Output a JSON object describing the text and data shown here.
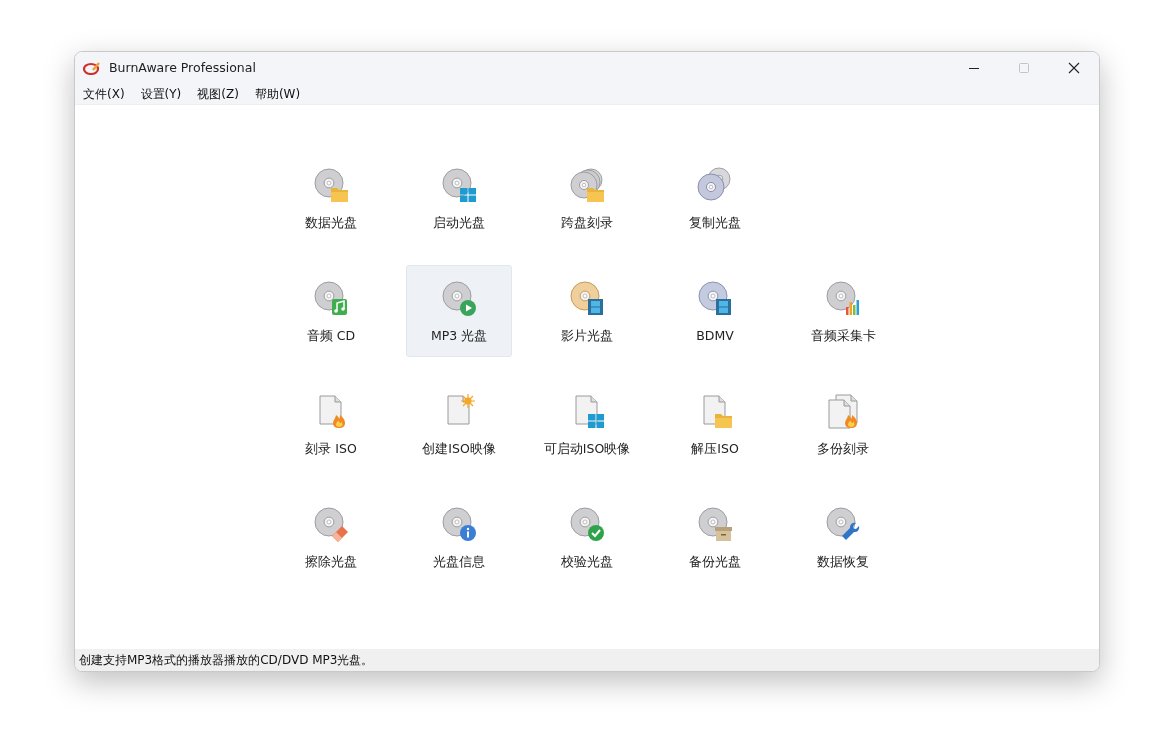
{
  "window": {
    "title": "BurnAware Professional",
    "maximize_disabled": true
  },
  "menu": [
    {
      "label": "文件(X)"
    },
    {
      "label": "设置(Y)"
    },
    {
      "label": "视图(Z)"
    },
    {
      "label": "帮助(W)"
    }
  ],
  "rows": [
    [
      {
        "label": "数据光盘",
        "kind": "datadisc",
        "selected": false
      },
      {
        "label": "启动光盘",
        "kind": "bootdisc",
        "selected": false
      },
      {
        "label": "跨盘刻录",
        "kind": "spandisc",
        "selected": false
      },
      {
        "label": "复制光盘",
        "kind": "copydisc",
        "selected": false
      }
    ],
    [
      {
        "label": "音频 CD",
        "kind": "audiocd",
        "selected": false
      },
      {
        "label": "MP3 光盘",
        "kind": "mp3disc",
        "selected": true
      },
      {
        "label": "影片光盘",
        "kind": "videodisc",
        "selected": false
      },
      {
        "label": "BDMV",
        "kind": "bdmv",
        "selected": false
      },
      {
        "label": "音频采集卡",
        "kind": "audiocapture",
        "selected": false
      }
    ],
    [
      {
        "label": "刻录 ISO",
        "kind": "burniso",
        "selected": false
      },
      {
        "label": "创建ISO映像",
        "kind": "makeiso",
        "selected": false
      },
      {
        "label": "可启动ISO映像",
        "kind": "bootiso",
        "selected": false
      },
      {
        "label": "解压ISO",
        "kind": "extractiso",
        "selected": false
      },
      {
        "label": "多份刻录",
        "kind": "multiburn",
        "selected": false
      }
    ],
    [
      {
        "label": "擦除光盘",
        "kind": "erasedisc",
        "selected": false
      },
      {
        "label": "光盘信息",
        "kind": "discinfo",
        "selected": false
      },
      {
        "label": "校验光盘",
        "kind": "verifydisc",
        "selected": false
      },
      {
        "label": "备份光盘",
        "kind": "backupdisc",
        "selected": false
      },
      {
        "label": "数据恢复",
        "kind": "recoverdisc",
        "selected": false
      }
    ]
  ],
  "status_bar": "创建支持MP3格式的播放器播放的CD/DVD MP3光盘。"
}
